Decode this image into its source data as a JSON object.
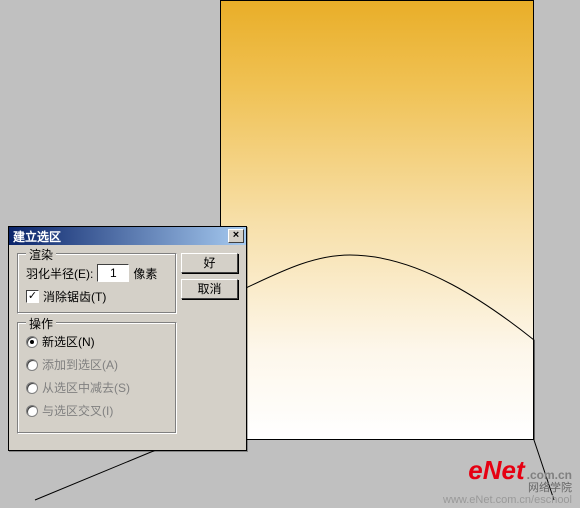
{
  "dialog": {
    "title": "建立选区",
    "buttons": {
      "ok": "好",
      "cancel": "取消"
    },
    "render": {
      "legend": "渲染",
      "feather_label": "羽化半径(E):",
      "feather_value": "1",
      "feather_unit": "像素",
      "antialias_label": "消除锯齿(T)",
      "antialias_checked": "✓"
    },
    "operation": {
      "legend": "操作",
      "options": [
        {
          "label": "新选区(N)",
          "selected": true,
          "disabled": false
        },
        {
          "label": "添加到选区(A)",
          "selected": false,
          "disabled": true
        },
        {
          "label": "从选区中减去(S)",
          "selected": false,
          "disabled": true
        },
        {
          "label": "与选区交叉(I)",
          "selected": false,
          "disabled": true
        }
      ]
    }
  },
  "watermark": {
    "logo_main": "eNet",
    "logo_suffix": ".com.cn",
    "logo_cn": "网络学院",
    "url": "www.eNet.com.cn/eschool"
  }
}
